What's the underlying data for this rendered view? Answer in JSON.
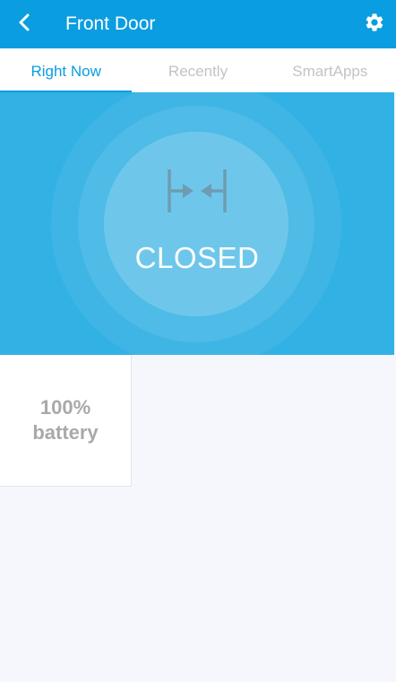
{
  "header": {
    "title": "Front Door",
    "back_icon": "chevron-left-icon",
    "settings_icon": "gear-icon",
    "background_color": "#0a9de0"
  },
  "tabs": [
    {
      "label": "Right Now",
      "active": true
    },
    {
      "label": "Recently",
      "active": false
    },
    {
      "label": "SmartApps",
      "active": false
    }
  ],
  "status_tile": {
    "icon": "contact-closed-icon",
    "state": "CLOSED",
    "color": "#32b1e4"
  },
  "battery_tile": {
    "value": "100%",
    "label": "battery"
  }
}
